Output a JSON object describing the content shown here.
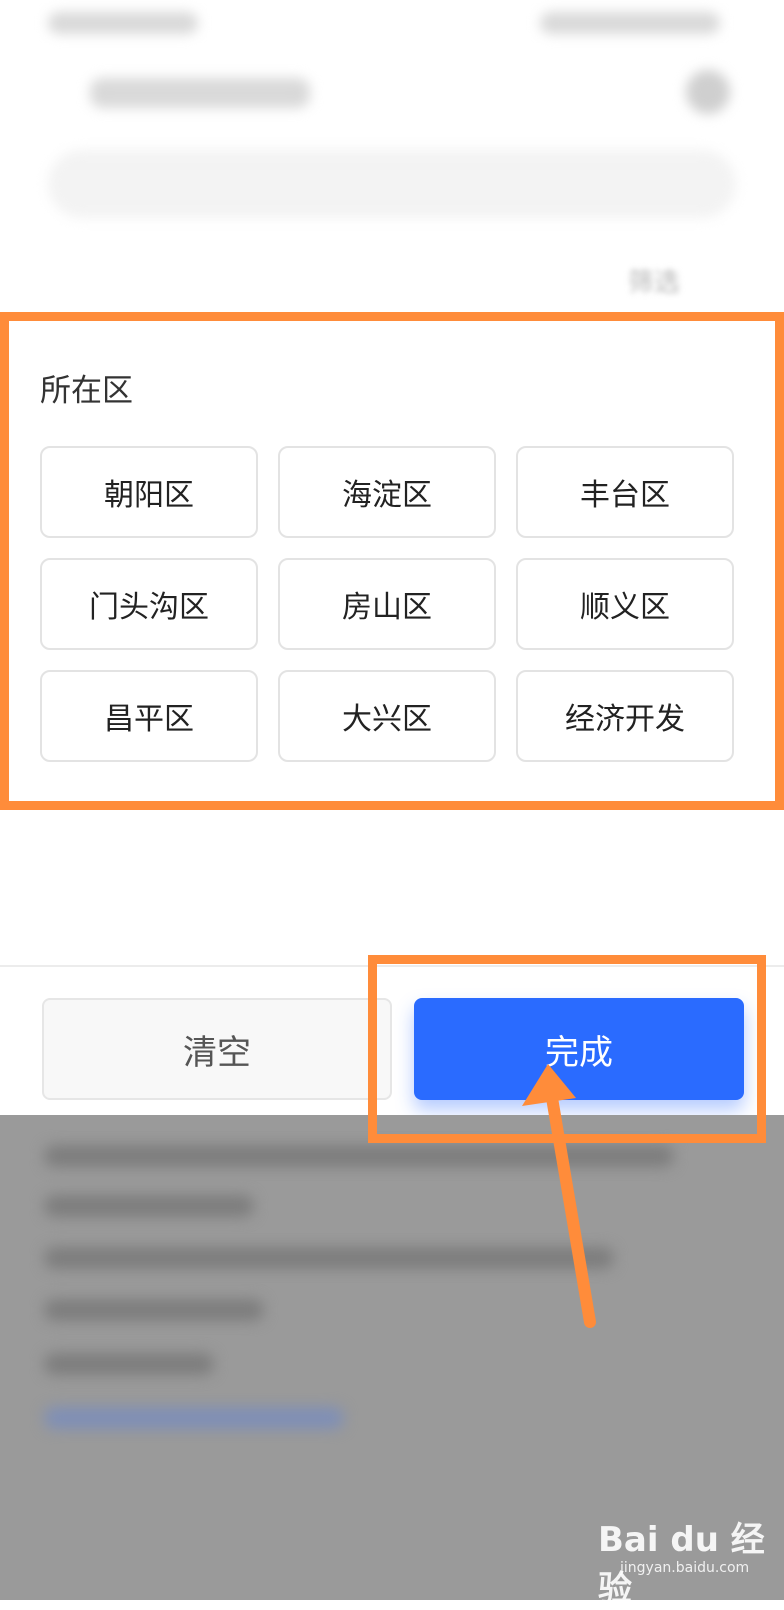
{
  "filter": {
    "section_title": "所在区",
    "options": [
      {
        "label": "朝阳区"
      },
      {
        "label": "海淀区"
      },
      {
        "label": "丰台区"
      },
      {
        "label": "门头沟区"
      },
      {
        "label": "房山区"
      },
      {
        "label": "顺义区"
      },
      {
        "label": "昌平区"
      },
      {
        "label": "大兴区"
      },
      {
        "label": "经济开发"
      }
    ]
  },
  "header": {
    "filter_label": "筛选"
  },
  "actions": {
    "clear_label": "清空",
    "done_label": "完成"
  },
  "watermark": {
    "brand": "Bai du 经验",
    "url": "jingyan.baidu.com"
  },
  "colors": {
    "primary": "#2a6bff",
    "annotation": "#ff8c3a"
  }
}
